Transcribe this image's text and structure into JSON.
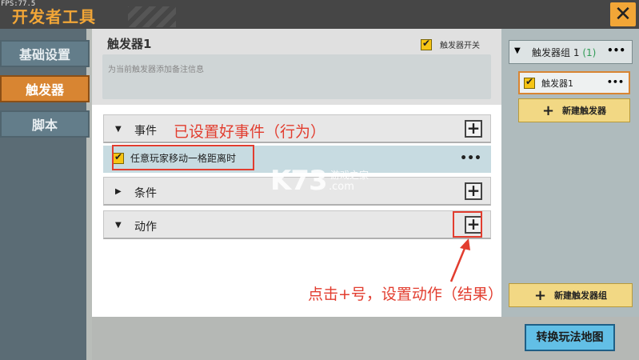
{
  "app": {
    "title": "开发者工具",
    "fps": "FPS:77.5"
  },
  "nav": {
    "items": [
      {
        "label": "基础设置"
      },
      {
        "label": "触发器"
      },
      {
        "label": "脚本"
      }
    ]
  },
  "trigger": {
    "name": "触发器1",
    "switch_label": "触发器开关",
    "note_placeholder": "为当前触发器添加备注信息",
    "sections": {
      "event": "事件",
      "condition": "条件",
      "action": "动作"
    },
    "event_item": "任意玩家移动一格距离时"
  },
  "annotations": {
    "event_done": "已设置好事件（行为）",
    "action_hint": "点击+号，设置动作（结果）"
  },
  "watermark": {
    "logo": "K73",
    "sub": "游戏之家",
    "domain": ".com"
  },
  "groups": {
    "group_label": "触发器组",
    "group_number": "1",
    "group_count": "(1)",
    "item": "触发器1",
    "new_trigger": "新建触发器",
    "new_group": "新建触发器组"
  },
  "footer": {
    "switch_map": "转换玩法地图"
  },
  "colors": {
    "accent": "#d88532",
    "annotation": "#e23d2f",
    "map_button": "#62bfe6"
  }
}
